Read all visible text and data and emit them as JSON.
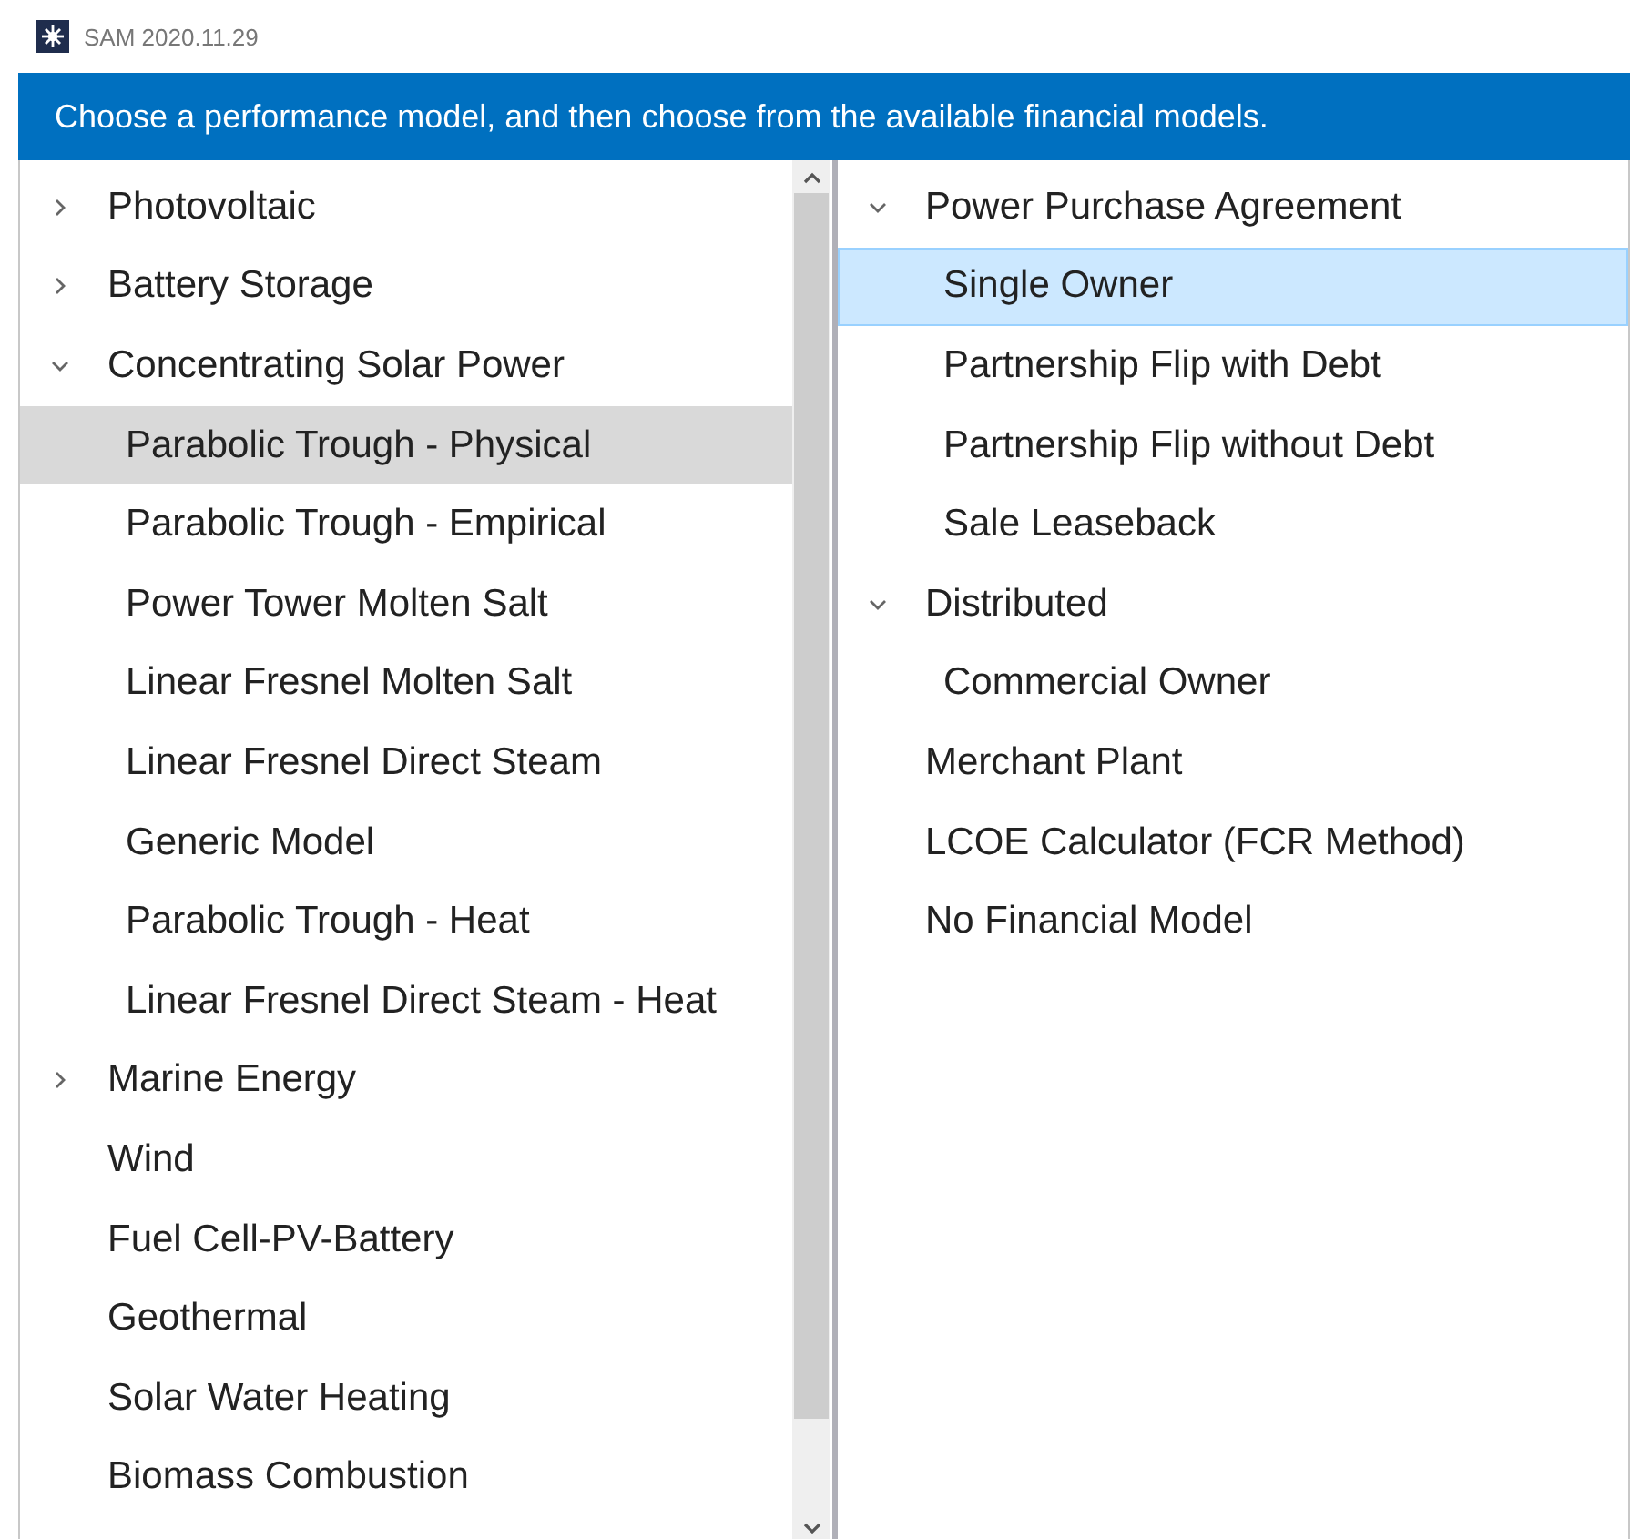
{
  "window": {
    "title": "SAM 2020.11.29"
  },
  "banner": "Choose a performance model, and then choose from the available financial models.",
  "performance_models": [
    {
      "label": "Photovoltaic",
      "expanded": false,
      "selected": false
    },
    {
      "label": "Battery Storage",
      "expanded": false,
      "selected": false
    },
    {
      "label": "Concentrating Solar Power",
      "expanded": true,
      "selected": false,
      "children": [
        {
          "label": "Parabolic Trough - Physical",
          "selected": true
        },
        {
          "label": "Parabolic Trough - Empirical",
          "selected": false
        },
        {
          "label": "Power Tower Molten Salt",
          "selected": false
        },
        {
          "label": "Linear Fresnel Molten Salt",
          "selected": false
        },
        {
          "label": "Linear Fresnel Direct Steam",
          "selected": false
        },
        {
          "label": "Generic Model",
          "selected": false
        },
        {
          "label": "Parabolic Trough - Heat",
          "selected": false
        },
        {
          "label": "Linear Fresnel Direct Steam - Heat",
          "selected": false
        }
      ]
    },
    {
      "label": "Marine Energy",
      "expanded": false,
      "selected": false
    },
    {
      "label": "Wind",
      "selected": false
    },
    {
      "label": "Fuel Cell-PV-Battery",
      "selected": false
    },
    {
      "label": "Geothermal",
      "selected": false
    },
    {
      "label": "Solar Water Heating",
      "selected": false
    },
    {
      "label": "Biomass Combustion",
      "selected": false
    }
  ],
  "financial_models": [
    {
      "label": "Power Purchase Agreement",
      "expanded": true,
      "selected": false,
      "children": [
        {
          "label": "Single Owner",
          "selected": true
        },
        {
          "label": "Partnership Flip with Debt",
          "selected": false
        },
        {
          "label": "Partnership Flip without Debt",
          "selected": false
        },
        {
          "label": "Sale Leaseback",
          "selected": false
        }
      ]
    },
    {
      "label": "Distributed",
      "expanded": true,
      "selected": false,
      "children": [
        {
          "label": "Commercial Owner",
          "selected": false
        }
      ]
    },
    {
      "label": "Merchant Plant",
      "selected": false
    },
    {
      "label": "LCOE Calculator (FCR Method)",
      "selected": false
    },
    {
      "label": "No Financial Model",
      "selected": false
    }
  ]
}
